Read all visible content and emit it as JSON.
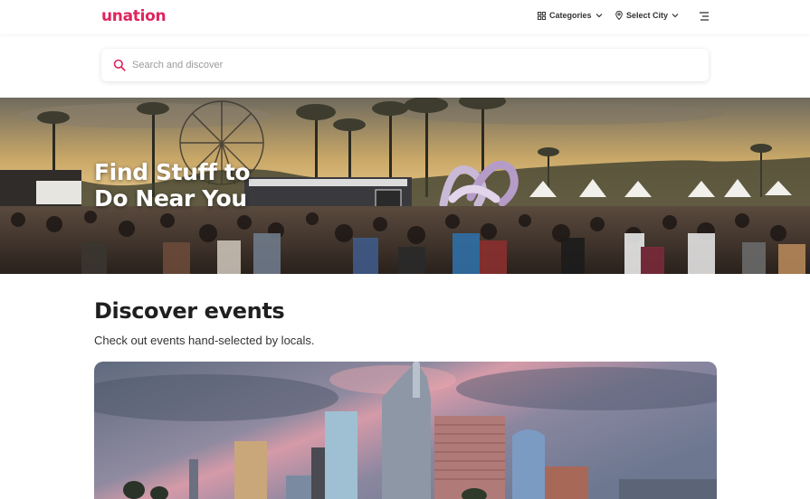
{
  "header": {
    "logo": "unation",
    "categories_label": "Categories",
    "city_label": "Select City",
    "brand_color": "#e0245e"
  },
  "search": {
    "placeholder": "Search and discover",
    "value": ""
  },
  "hero": {
    "title_line1": "Find Stuff to",
    "title_line2": "Do Near You"
  },
  "discover": {
    "title": "Discover events",
    "subtitle": "Check out events hand-selected by locals."
  },
  "icons": {
    "categories": "grid-icon",
    "city": "location-pin-icon",
    "menu": "hamburger-menu-icon",
    "search": "search-icon",
    "dropdown": "chevron-down-icon"
  }
}
